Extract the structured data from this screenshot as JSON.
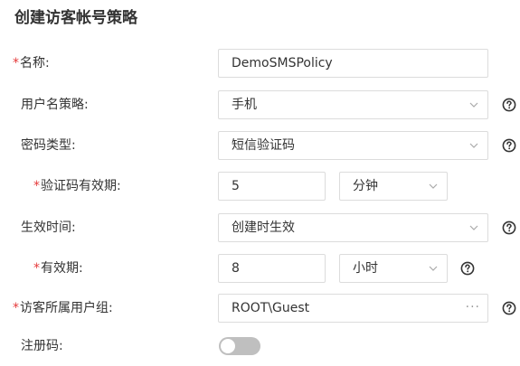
{
  "page": {
    "title": "创建访客帐号策略"
  },
  "form": {
    "name": {
      "label": "名称:",
      "required_mark": "*",
      "value": "DemoSMSPolicy"
    },
    "username_policy": {
      "label": "用户名策略:",
      "value": "手机"
    },
    "password_type": {
      "label": "密码类型:",
      "value": "短信验证码"
    },
    "code_validity": {
      "label": "验证码有效期:",
      "required_mark": "*",
      "value": "5",
      "unit": "分钟"
    },
    "effective_time": {
      "label": "生效时间:",
      "value": "创建时生效"
    },
    "validity_period": {
      "label": "有效期:",
      "required_mark": "*",
      "value": "8",
      "unit": "小时"
    },
    "user_group": {
      "label": "访客所属用户组:",
      "required_mark": "*",
      "value": "ROOT\\Guest",
      "more": "···"
    },
    "registration_code": {
      "label": "注册码:",
      "enabled": false
    }
  },
  "colors": {
    "required": "#e5393a",
    "border": "#dcdcdc",
    "toggle_off": "#bfbfbf",
    "help_icon": "#333333"
  }
}
